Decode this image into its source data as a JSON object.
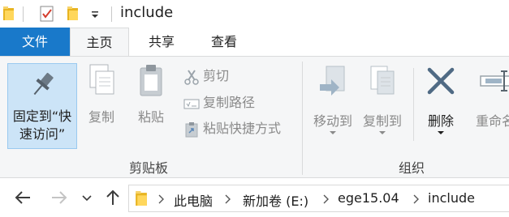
{
  "window": {
    "title": "include"
  },
  "tabs": {
    "file": "文件",
    "home": "主页",
    "share": "共享",
    "view": "查看"
  },
  "clipboard": {
    "pin_label_line1": "固定到“快",
    "pin_label_line2": "速访问”",
    "copy": "复制",
    "paste": "粘贴",
    "cut": "剪切",
    "copy_path": "复制路径",
    "paste_shortcut": "粘贴快捷方式",
    "group_label": "剪贴板"
  },
  "organize": {
    "move_to": "移动到",
    "copy_to": "复制到",
    "delete": "删除",
    "rename": "重命名",
    "group_label": "组织"
  },
  "address": {
    "crumbs": [
      "此电脑",
      "新加卷 (E:)",
      "ege15.04",
      "include"
    ]
  },
  "colors": {
    "accent": "#1979ca",
    "selected_bg": "#cce4f7",
    "disabled_text": "#8a8a8a"
  }
}
